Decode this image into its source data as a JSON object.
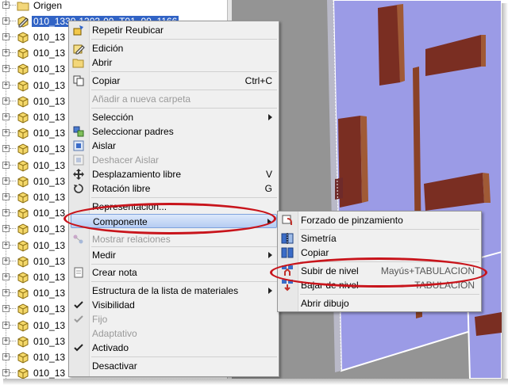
{
  "tree": {
    "origin_label": "Origen",
    "selected_label": "010_1330-1303-00_T01_00_1166",
    "component_label": "010_13",
    "row_count": 23
  },
  "context_menu": {
    "items": [
      {
        "label": "Repetir Reubicar",
        "icon": "reposition-icon",
        "enabled": true
      },
      {
        "label": "Edición",
        "icon": "edit-icon",
        "enabled": true
      },
      {
        "label": "Abrir",
        "icon": "open-icon",
        "enabled": true
      },
      {
        "label": "Copiar",
        "icon": "copy-icon",
        "shortcut": "Ctrl+C",
        "enabled": true
      },
      {
        "label": "Añadir a nueva carpeta",
        "enabled": false
      },
      {
        "label": "Selección",
        "submenu": true,
        "enabled": true
      },
      {
        "label": "Seleccionar padres",
        "icon": "select-parents-icon",
        "enabled": true
      },
      {
        "label": "Aislar",
        "icon": "isolate-icon",
        "enabled": true
      },
      {
        "label": "Deshacer Aislar",
        "icon": "undo-isolate-icon",
        "enabled": false
      },
      {
        "label": "Desplazamiento libre",
        "icon": "free-move-icon",
        "shortcut": "V",
        "enabled": true
      },
      {
        "label": "Rotación libre",
        "icon": "free-rotate-icon",
        "shortcut": "G",
        "enabled": true
      },
      {
        "label": "Representación...",
        "enabled": true
      },
      {
        "label": "Componente",
        "submenu": true,
        "enabled": true,
        "highlighted": true
      },
      {
        "label": "Mostrar relaciones",
        "icon": "relations-icon",
        "enabled": false
      },
      {
        "label": "Medir",
        "submenu": true,
        "enabled": true
      },
      {
        "label": "Crear nota",
        "icon": "note-icon",
        "enabled": true
      },
      {
        "label": "Estructura de la lista de materiales",
        "submenu": true,
        "enabled": true
      },
      {
        "label": "Visibilidad",
        "check": true,
        "enabled": true
      },
      {
        "label": "Fijo",
        "check": true,
        "enabled": false
      },
      {
        "label": "Adaptativo",
        "enabled": false
      },
      {
        "label": "Activado",
        "check": true,
        "enabled": true
      },
      {
        "label": "Desactivar",
        "enabled": true
      }
    ]
  },
  "submenu": {
    "items": [
      {
        "label": "Forzado de pinzamiento",
        "icon": "grip-snap-icon"
      },
      {
        "label": "Simetría",
        "icon": "mirror-icon"
      },
      {
        "label": "Copiar",
        "icon": "copy-component-icon"
      },
      {
        "label": "Subir de nivel",
        "icon": "promote-icon",
        "shortcut": "Mayús+TABULACION",
        "highlighted": true
      },
      {
        "label": "Bajar de nivel",
        "icon": "demote-icon",
        "shortcut": "TABULACION"
      },
      {
        "label": "Abrir dibujo"
      }
    ]
  },
  "colors": {
    "annotation_ring": "#c8141b",
    "menu_highlight": "#b5ccf2",
    "tree_selection": "#3163c5",
    "viewport_panel": "#9b9be6",
    "viewport_bars": "#7a2e22"
  }
}
